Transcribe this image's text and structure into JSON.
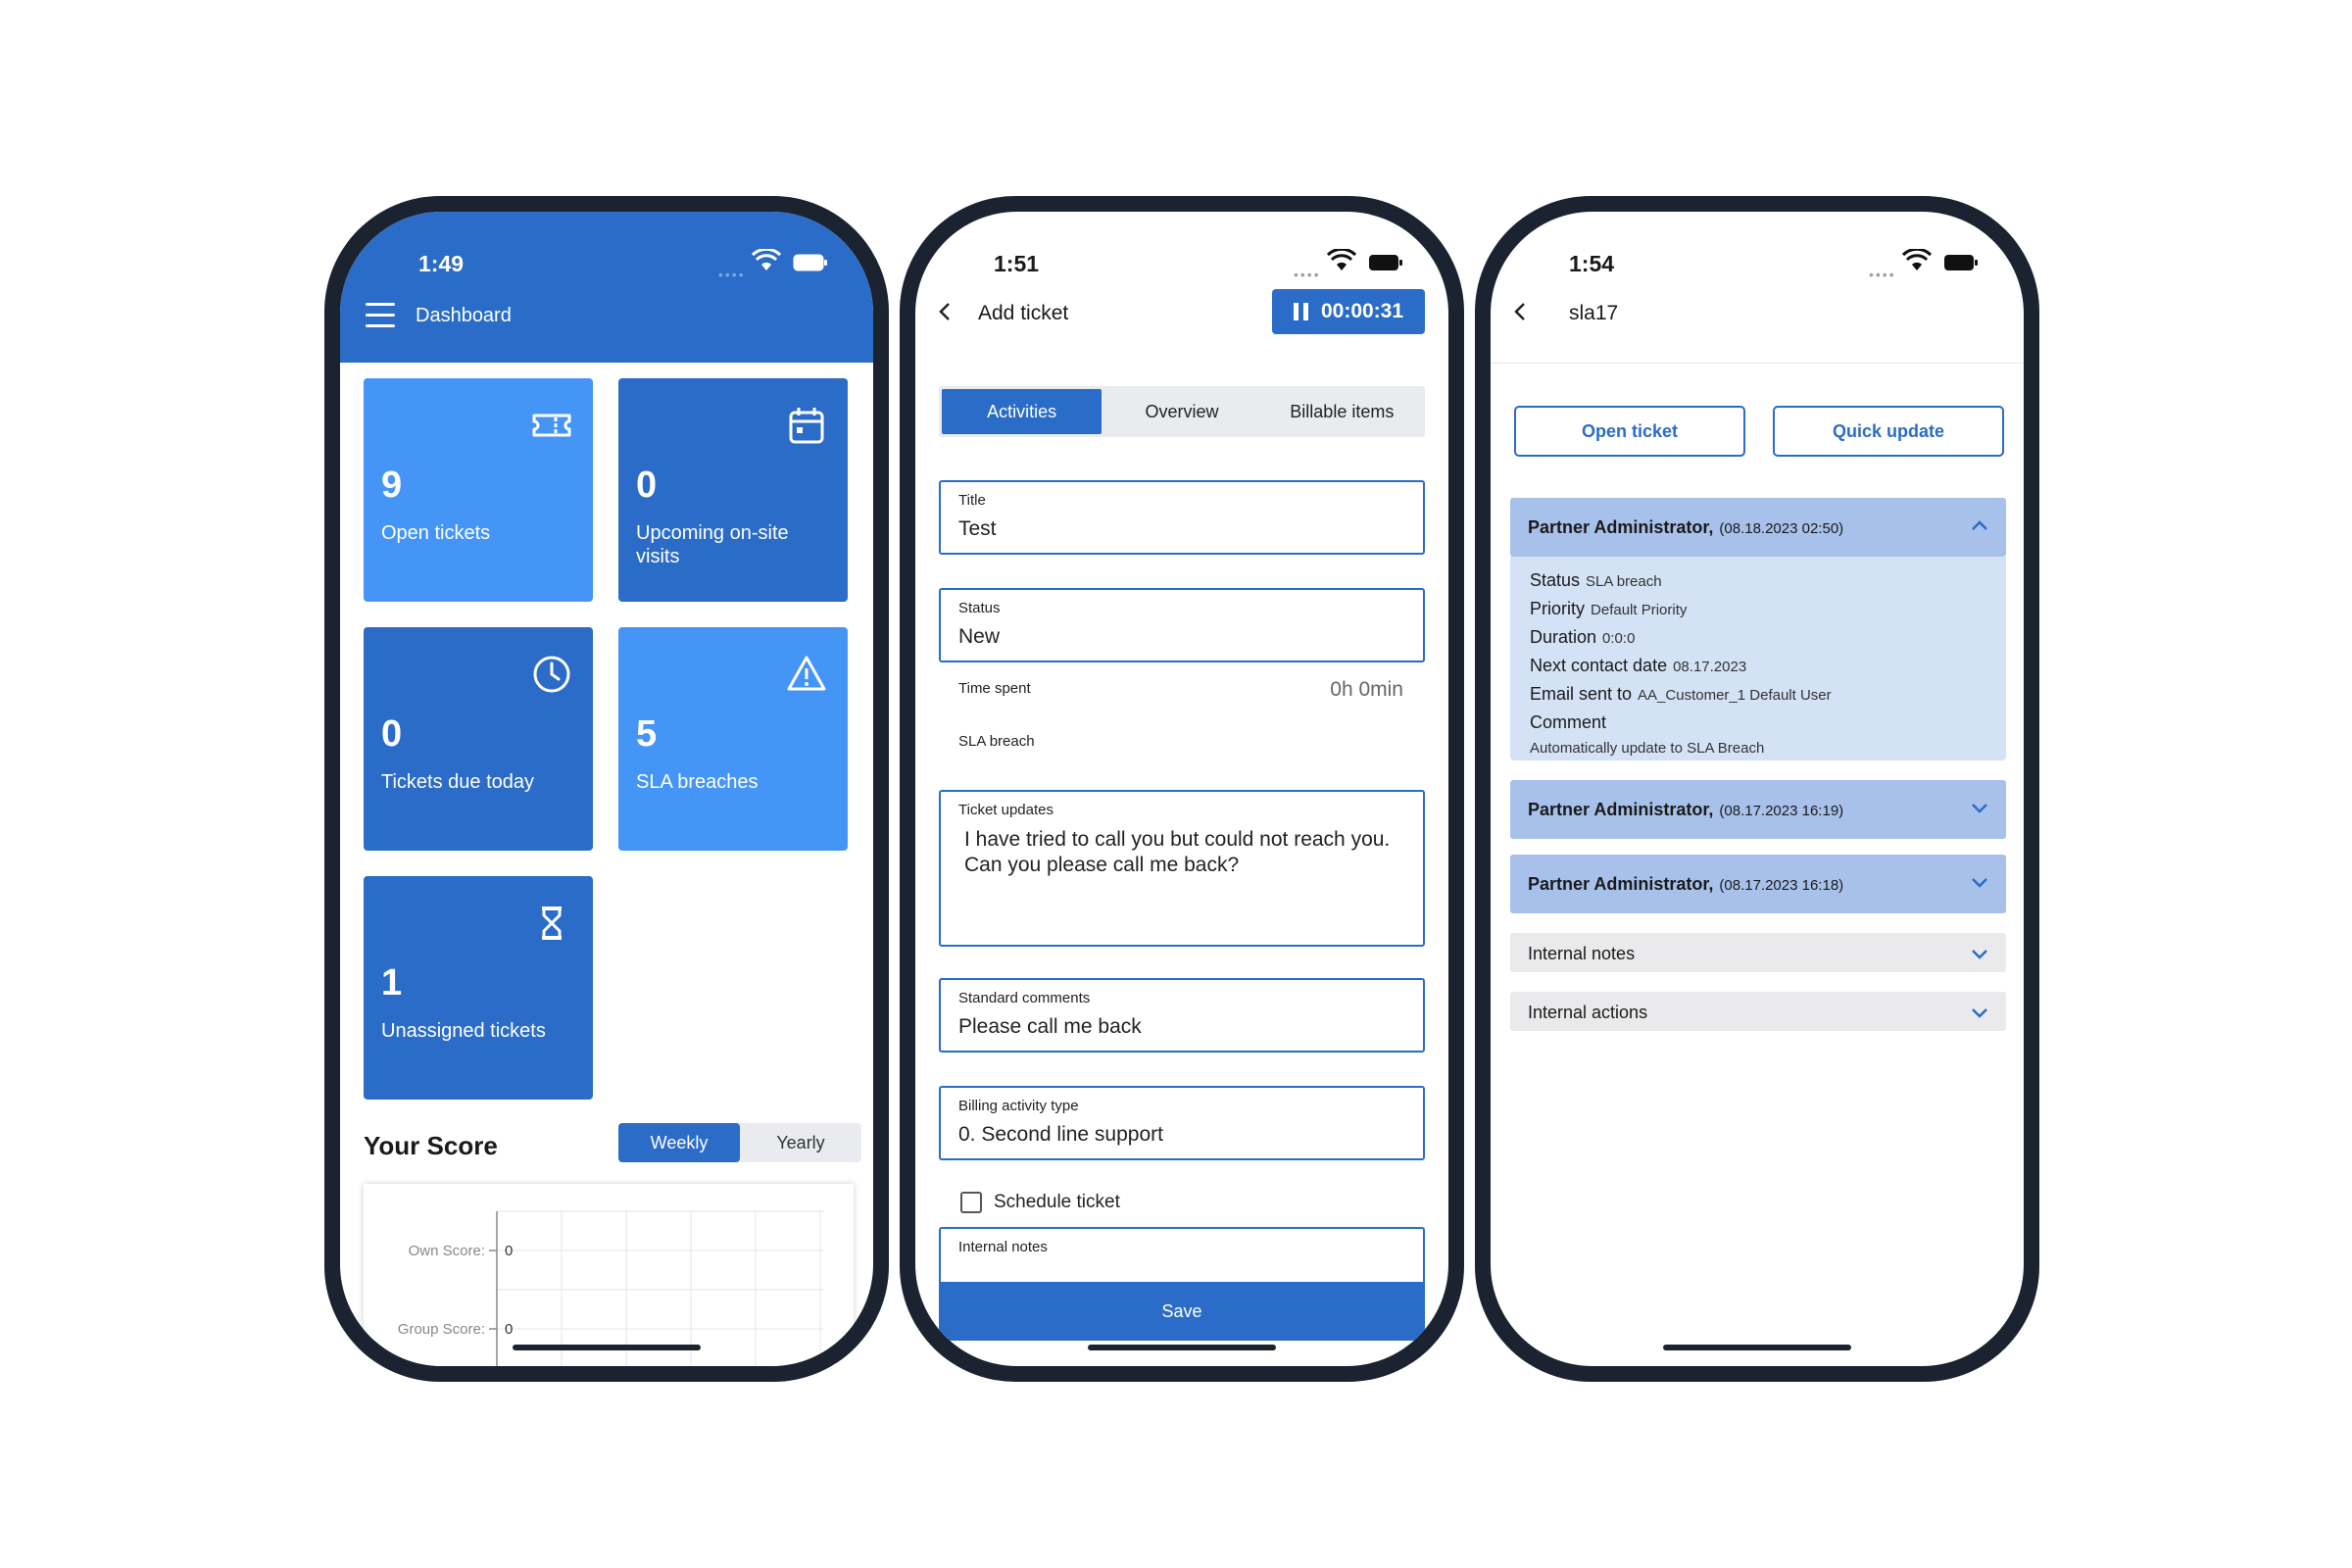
{
  "phones": [
    {
      "status_time": "1:49",
      "header": {
        "title": "Dashboard"
      },
      "tiles": [
        {
          "value": "9",
          "label": "Open tickets",
          "icon": "ticket-icon"
        },
        {
          "value": "0",
          "label": "Upcoming on-site visits",
          "icon": "calendar-icon"
        },
        {
          "value": "0",
          "label": "Tickets due today",
          "icon": "clock-icon"
        },
        {
          "value": "5",
          "label": "SLA breaches",
          "icon": "warning-icon"
        },
        {
          "value": "1",
          "label": "Unassigned tickets",
          "icon": "hourglass-icon"
        }
      ],
      "score": {
        "title": "Your Score",
        "toggle": [
          "Weekly",
          "Yearly"
        ],
        "active": "Weekly",
        "chart": {
          "rows": [
            {
              "label": "Own Score:",
              "value": "0"
            },
            {
              "label": "Group Score:",
              "value": "0"
            }
          ]
        }
      }
    },
    {
      "status_time": "1:51",
      "nav": {
        "title": "Add ticket",
        "timer": "00:00:31"
      },
      "tabs": [
        "Activities",
        "Overview",
        "Billable items"
      ],
      "active_tab": "Activities",
      "fields": {
        "title": {
          "label": "Title",
          "value": "Test"
        },
        "status": {
          "label": "Status",
          "value": "New"
        },
        "time_spent": {
          "label": "Time spent",
          "value": "0h 0min"
        },
        "sla": {
          "label": "SLA breach"
        },
        "ticket_updates": {
          "label": "Ticket updates",
          "value": "I have tried to call you but could not reach you. Can you please call me back?"
        },
        "standard_comments": {
          "label": "Standard comments",
          "value": "Please call me back"
        },
        "billing": {
          "label": "Billing activity type",
          "value": "0. Second line support"
        },
        "schedule": {
          "label": "Schedule ticket"
        },
        "internal_notes": {
          "label": "Internal notes"
        }
      },
      "save_label": "Save"
    },
    {
      "status_time": "1:54",
      "nav": {
        "title": "sla17"
      },
      "buttons": {
        "open_ticket": "Open ticket",
        "quick_update": "Quick update"
      },
      "entries": [
        {
          "name": "Partner Administrator,",
          "date": "(08.18.2023 02:50)",
          "expanded": true,
          "details": [
            {
              "key": "Status",
              "value": "SLA breach"
            },
            {
              "key": "Priority",
              "value": "Default Priority"
            },
            {
              "key": "Duration",
              "value": "0:0:0"
            },
            {
              "key": "Next contact date",
              "value": "08.17.2023"
            },
            {
              "key": "Email sent to",
              "value": "AA_Customer_1 Default User"
            }
          ],
          "comment_label": "Comment",
          "comment": "Automatically update to SLA Breach"
        },
        {
          "name": "Partner Administrator,",
          "date": "(08.17.2023 16:19)",
          "expanded": false
        },
        {
          "name": "Partner Administrator,",
          "date": "(08.17.2023 16:18)",
          "expanded": false
        }
      ],
      "sections": [
        "Internal notes",
        "Internal actions"
      ]
    }
  ],
  "colors": {
    "primary": "#2a6cc7",
    "tile_light": "#4495f6",
    "accordion": "#a7c1eb",
    "accordion_body": "#d4e2f6",
    "frame": "#1b2230"
  }
}
